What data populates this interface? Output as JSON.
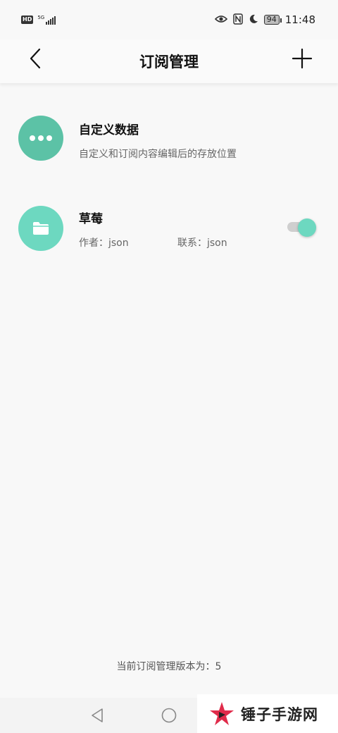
{
  "status_bar": {
    "left_badge": "HD",
    "network": "5G",
    "right_icons": [
      "eye-icon",
      "nfc-icon",
      "moon-icon"
    ],
    "battery": "94",
    "time": "11:48"
  },
  "header": {
    "title": "订阅管理",
    "back_icon": "chevron-left-icon",
    "add_icon": "plus-icon"
  },
  "items": [
    {
      "title": "自定义数据",
      "description": "自定义和订阅内容编辑后的存放位置",
      "icon": "more-dots-icon",
      "icon_color": "#5cc2a6"
    },
    {
      "title": "草莓",
      "author": "作者：json",
      "contact": "联系：json",
      "icon": "folder-icon",
      "icon_color": "#6dd8c0",
      "enabled": true
    }
  ],
  "footer": {
    "version_text": "当前订阅管理版本为：5"
  },
  "watermark": {
    "text": "锤子手游网"
  },
  "colors": {
    "accent": "#6dd8c0",
    "background": "#f8f8f8"
  }
}
